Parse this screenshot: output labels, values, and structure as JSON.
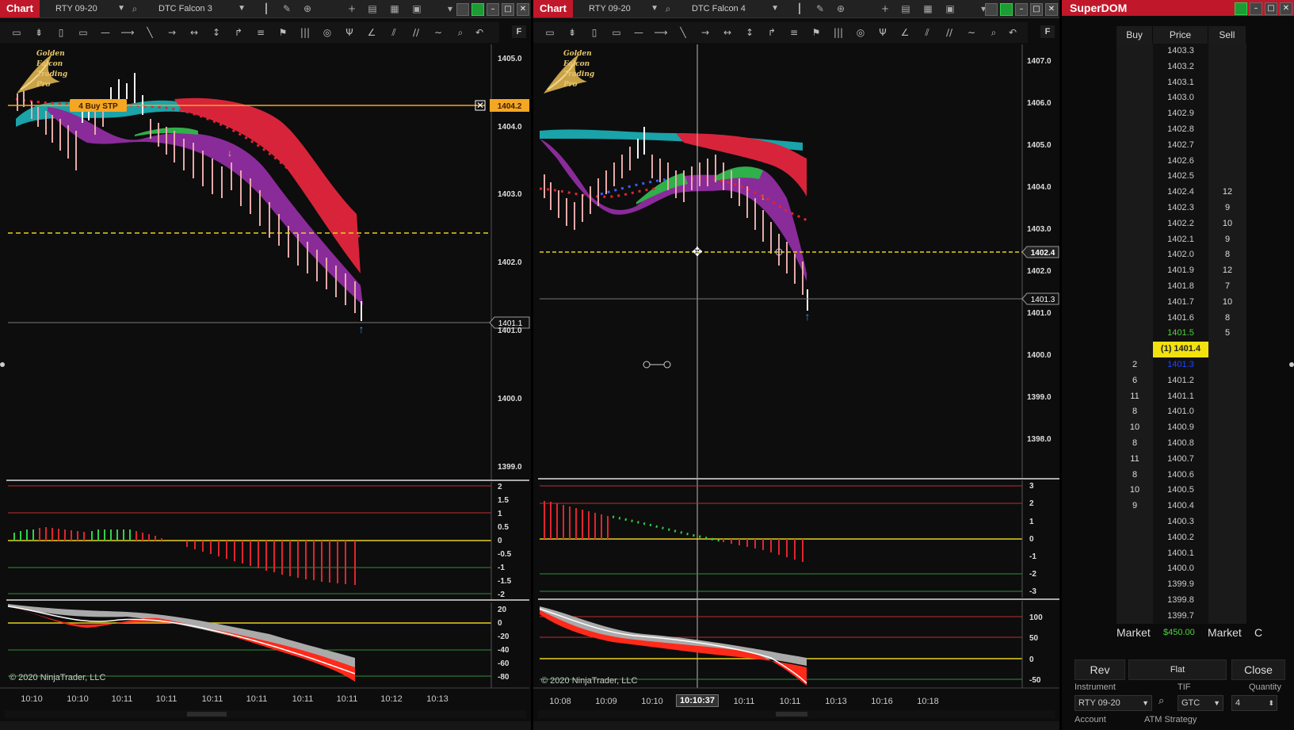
{
  "left": {
    "tag": "Chart",
    "instrument": "RTY 09-20",
    "template": "DTC Falcon 3",
    "logo": "Golden Falcon Trading Pro",
    "order_label": "4 Buy STP",
    "order_price": "1404.2",
    "last_price": "1401.1",
    "price_axis": [
      "1405.0",
      "1404.0",
      "1403.0",
      "1402.0",
      "1401.0",
      "1400.0",
      "1399.0"
    ],
    "ind1_axis": [
      "2",
      "1.5",
      "1",
      "0.5",
      "0",
      "-0.5",
      "-1",
      "-1.5",
      "-2"
    ],
    "ind2_axis": [
      "20",
      "0",
      "-20",
      "-40",
      "-60",
      "-80"
    ],
    "time_axis": [
      "10:10",
      "10:10",
      "10:11",
      "10:11",
      "10:11",
      "10:11",
      "10:11",
      "10:11",
      "10:12",
      "10:13"
    ],
    "copyright": "© 2020 NinjaTrader, LLC"
  },
  "right": {
    "tag": "Chart",
    "instrument": "RTY 09-20",
    "template": "DTC Falcon 4",
    "logo": "Golden Falcon Trading Pro",
    "price_axis": [
      "1407.0",
      "1406.0",
      "1405.0",
      "1404.0",
      "1403.0",
      "1402.0",
      "1401.0",
      "1400.0",
      "1399.0",
      "1398.0"
    ],
    "crosshair_price": "1402.4",
    "last_price": "1401.3",
    "ind1_axis": [
      "3",
      "2",
      "1",
      "0",
      "-1",
      "-2",
      "-3"
    ],
    "ind2_axis": [
      "100",
      "50",
      "0",
      "-50"
    ],
    "time_axis": [
      "10:08",
      "10:09",
      "10:10",
      "10:10:37",
      "10:11",
      "10:11",
      "10:13",
      "10:16",
      "10:18"
    ],
    "copyright": "© 2020 NinjaTrader, LLC"
  },
  "superdom": {
    "title": "SuperDOM",
    "headers": {
      "buy": "Buy",
      "price": "Price",
      "sell": "Sell"
    },
    "rows": [
      {
        "buy": "",
        "price": "1403.3",
        "sell": "",
        "state": ""
      },
      {
        "buy": "",
        "price": "1403.2",
        "sell": "",
        "state": ""
      },
      {
        "buy": "",
        "price": "1403.1",
        "sell": "",
        "state": ""
      },
      {
        "buy": "",
        "price": "1403.0",
        "sell": "",
        "state": ""
      },
      {
        "buy": "",
        "price": "1402.9",
        "sell": "",
        "state": ""
      },
      {
        "buy": "",
        "price": "1402.8",
        "sell": "",
        "state": ""
      },
      {
        "buy": "",
        "price": "1402.7",
        "sell": "",
        "state": ""
      },
      {
        "buy": "",
        "price": "1402.6",
        "sell": "",
        "state": ""
      },
      {
        "buy": "",
        "price": "1402.5",
        "sell": "",
        "state": ""
      },
      {
        "buy": "",
        "price": "1402.4",
        "sell": "12",
        "state": ""
      },
      {
        "buy": "",
        "price": "1402.3",
        "sell": "9",
        "state": ""
      },
      {
        "buy": "",
        "price": "1402.2",
        "sell": "10",
        "state": ""
      },
      {
        "buy": "",
        "price": "1402.1",
        "sell": "9",
        "state": ""
      },
      {
        "buy": "",
        "price": "1402.0",
        "sell": "8",
        "state": ""
      },
      {
        "buy": "",
        "price": "1401.9",
        "sell": "12",
        "state": ""
      },
      {
        "buy": "",
        "price": "1401.8",
        "sell": "7",
        "state": ""
      },
      {
        "buy": "",
        "price": "1401.7",
        "sell": "10",
        "state": ""
      },
      {
        "buy": "",
        "price": "1401.6",
        "sell": "8",
        "state": ""
      },
      {
        "buy": "",
        "price": "1401.5",
        "sell": "5",
        "state": "last"
      },
      {
        "buy": "",
        "price": "(1) 1401.4",
        "sell": "",
        "state": "cur"
      },
      {
        "buy": "2",
        "price": "1401.3",
        "sell": "",
        "state": "bid"
      },
      {
        "buy": "6",
        "price": "1401.2",
        "sell": "",
        "state": ""
      },
      {
        "buy": "11",
        "price": "1401.1",
        "sell": "",
        "state": ""
      },
      {
        "buy": "8",
        "price": "1401.0",
        "sell": "",
        "state": ""
      },
      {
        "buy": "10",
        "price": "1400.9",
        "sell": "",
        "state": ""
      },
      {
        "buy": "8",
        "price": "1400.8",
        "sell": "",
        "state": ""
      },
      {
        "buy": "11",
        "price": "1400.7",
        "sell": "",
        "state": ""
      },
      {
        "buy": "8",
        "price": "1400.6",
        "sell": "",
        "state": ""
      },
      {
        "buy": "10",
        "price": "1400.5",
        "sell": "",
        "state": ""
      },
      {
        "buy": "9",
        "price": "1400.4",
        "sell": "",
        "state": ""
      },
      {
        "buy": "",
        "price": "1400.3",
        "sell": "",
        "state": ""
      },
      {
        "buy": "",
        "price": "1400.2",
        "sell": "",
        "state": ""
      },
      {
        "buy": "",
        "price": "1400.1",
        "sell": "",
        "state": ""
      },
      {
        "buy": "",
        "price": "1400.0",
        "sell": "",
        "state": ""
      },
      {
        "buy": "",
        "price": "1399.9",
        "sell": "",
        "state": ""
      },
      {
        "buy": "",
        "price": "1399.8",
        "sell": "",
        "state": ""
      },
      {
        "buy": "",
        "price": "1399.7",
        "sell": "",
        "state": ""
      }
    ],
    "market_buy": "Market",
    "pnl": "$450.00",
    "market_sell": "Market",
    "c_label": "C",
    "rev": "Rev",
    "flat": "Flat",
    "close": "Close",
    "instrument_label": "Instrument",
    "instrument_value": "RTY 09-20",
    "tif_label": "TIF",
    "tif_value": "GTC",
    "quantity_label": "Quantity",
    "quantity_value": "4",
    "account_label": "Account",
    "atm_label": "ATM Strategy"
  },
  "colors": {
    "accent_red": "#c0182a",
    "cloud_red": "#d8243a",
    "cloud_purple": "#8a2b9a",
    "cloud_teal": "#1aa3a8",
    "cloud_green": "#2fb04a",
    "order_orange": "#f5a623",
    "dashed_yellow": "#e6d21a",
    "last_green": "#4dd23f",
    "current_yellow": "#f2e10f"
  }
}
